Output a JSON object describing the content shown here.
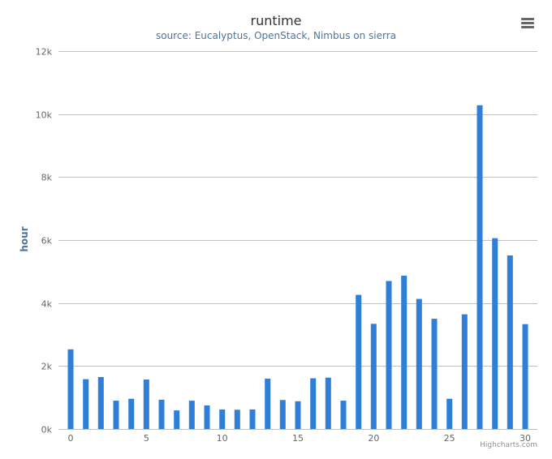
{
  "title": "runtime",
  "subtitle": "source: Eucalyptus, OpenStack, Nimbus on sierra",
  "credits": "Highcharts.com",
  "menu_icon": "hamburger-menu-icon",
  "colors": {
    "bar": "#2f7ed8",
    "grid": "#c0c0c0",
    "axis_text": "#666666",
    "title": "#333333",
    "subtitle": "#4d759e"
  },
  "chart_data": {
    "type": "bar",
    "title": "runtime",
    "subtitle": "source: Eucalyptus, OpenStack, Nimbus on sierra",
    "xlabel": "",
    "ylabel": "hour",
    "x": [
      0,
      1,
      2,
      3,
      4,
      5,
      6,
      7,
      8,
      9,
      10,
      11,
      12,
      13,
      14,
      15,
      16,
      17,
      18,
      19,
      20,
      21,
      22,
      23,
      24,
      25,
      26,
      27,
      28,
      29,
      30
    ],
    "values": [
      2530,
      1580,
      1650,
      900,
      960,
      1570,
      930,
      590,
      900,
      750,
      620,
      610,
      620,
      1600,
      920,
      880,
      1610,
      1630,
      900,
      4260,
      3340,
      4700,
      4870,
      4130,
      3500,
      960,
      3640,
      10280,
      6060,
      5510,
      3330
    ],
    "xlim": [
      0,
      30
    ],
    "ylim": [
      0,
      12000
    ],
    "x_ticks": [
      0,
      5,
      10,
      15,
      20,
      25,
      30
    ],
    "y_ticks": [
      0,
      2000,
      4000,
      6000,
      8000,
      10000,
      12000
    ],
    "y_tick_labels": [
      "0k",
      "2k",
      "4k",
      "6k",
      "8k",
      "10k",
      "12k"
    ],
    "grid": true,
    "legend": "none"
  }
}
